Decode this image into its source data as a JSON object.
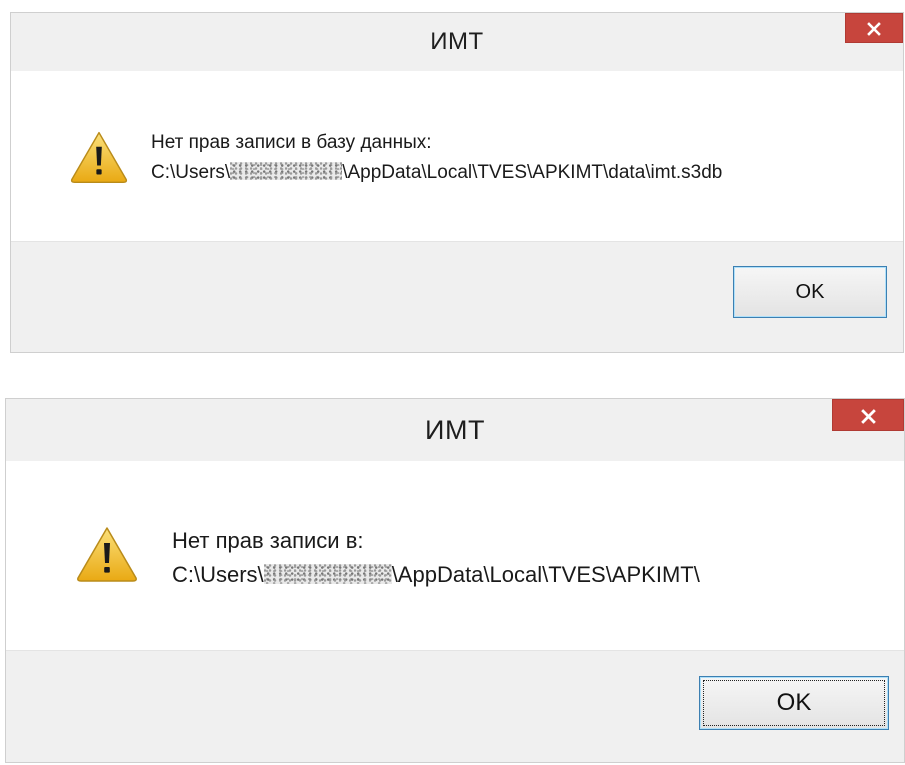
{
  "dialogs": [
    {
      "title": "ИМТ",
      "close_label": "×",
      "icon": "warning-icon",
      "message_line1": "Нет прав записи в базу данных:",
      "path_prefix": "C:\\Users\\",
      "path_suffix": "\\AppData\\Local\\TVES\\APKIMT\\data\\imt.s3db",
      "ok_label": "OK"
    },
    {
      "title": "ИМТ",
      "close_label": "×",
      "icon": "warning-icon",
      "message_line1": "Нет прав записи в:",
      "path_prefix": "C:\\Users\\",
      "path_suffix": "\\AppData\\Local\\TVES\\APKIMT\\",
      "ok_label": "OK"
    }
  ],
  "colors": {
    "close_button": "#c7453d",
    "chrome": "#f0f0f0",
    "content": "#ffffff",
    "focus_border": "#3c7fb1",
    "warning_fill": "#f2c12e"
  }
}
